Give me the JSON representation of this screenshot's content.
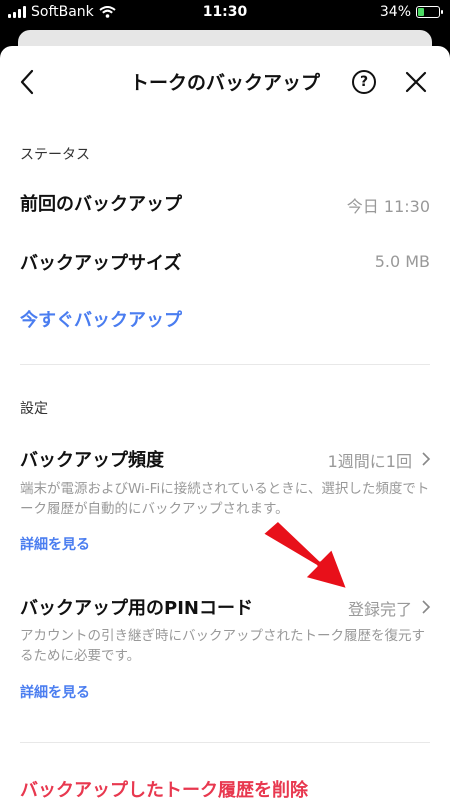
{
  "status_bar": {
    "carrier": "SoftBank",
    "time": "11:30",
    "battery_percent": "34%",
    "battery_level": 0.34
  },
  "nav": {
    "title": "トークのバックアップ",
    "help_symbol": "?"
  },
  "status_section": {
    "label": "ステータス",
    "last_backup_label": "前回のバックアップ",
    "last_backup_value": "今日 11:30",
    "size_label": "バックアップサイズ",
    "size_value": "5.0 MB",
    "backup_now": "今すぐバックアップ"
  },
  "settings_section": {
    "label": "設定",
    "frequency_label": "バックアップ頻度",
    "frequency_value": "1週間に1回",
    "frequency_desc": "端末が電源およびWi-Fiに接続されているときに、選択した頻度でトーク履歴が自動的にバックアップされます。",
    "frequency_more": "詳細を見る",
    "pin_label": "バックアップ用のPINコード",
    "pin_value": "登録完了",
    "pin_desc": "アカウントの引き継ぎ時にバックアップされたトーク履歴を復元するために必要です。",
    "pin_more": "詳細を見る"
  },
  "delete_label": "バックアップしたトーク履歴を削除",
  "colors": {
    "accent": "#4a7df0",
    "danger": "#e8384f",
    "arrow": "#e8101a"
  }
}
